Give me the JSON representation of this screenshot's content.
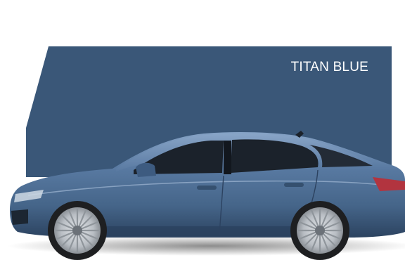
{
  "color_label": "TITAN BLUE",
  "colors": {
    "background": "#ffffff",
    "panel": "#3a5778",
    "car_body": "#4e6f96",
    "car_body_dark": "#2f4766",
    "car_body_light": "#7e9cc0",
    "glass": "#1b222b",
    "wheel_rim": "#c9ced3",
    "tyre": "#1e1f21",
    "tail_light": "#b2343f"
  },
  "icons": {
    "car": "car-side-view-image"
  }
}
